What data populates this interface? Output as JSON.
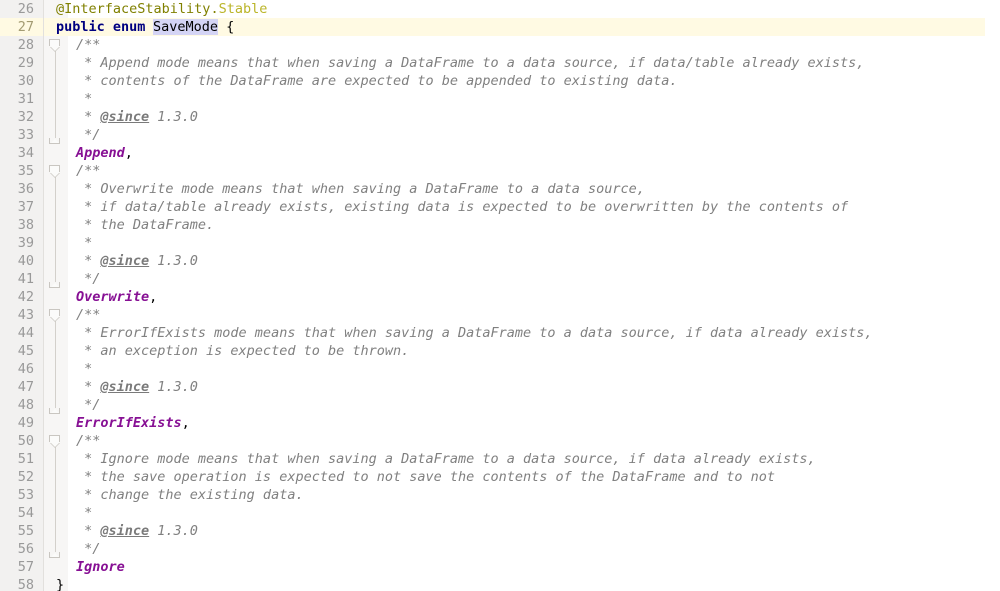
{
  "editor": {
    "language": "java",
    "theme": "light",
    "font_size_px": 13.5,
    "line_height_px": 18,
    "first_line_number": 26,
    "last_line_number": 58,
    "caret_line_number": 27,
    "caret_line_bg": "#fffae3",
    "selection_text": "SaveMode",
    "selection_bg": "#d4d4f5",
    "gutter_bg": "#f2f1f0",
    "fold_strip_bg": "#f7f6f5",
    "background": "#ffffff",
    "colors": {
      "line_number": "#999999",
      "keyword": "#000080",
      "annotation": "#808000",
      "annotation_type": "#bbb529",
      "comment": "#808080",
      "javadoc_tag": "#7a7a7a",
      "enum_constant": "#871094",
      "plain_text": "#000000"
    }
  },
  "lines": [
    {
      "num": "26",
      "indent": 0,
      "tokens": [
        {
          "t": "@InterfaceStability",
          "c": "anno"
        },
        {
          "t": ".",
          "c": "anno"
        },
        {
          "t": "Stable",
          "c": "anno-t"
        }
      ]
    },
    {
      "num": "27",
      "indent": 0,
      "tokens": [
        {
          "t": "public",
          "c": "kw"
        },
        {
          "t": " ",
          "c": "plain"
        },
        {
          "t": "enum",
          "c": "kw"
        },
        {
          "t": " ",
          "c": "plain"
        },
        {
          "t": "SaveMode",
          "c": "sel-caret"
        },
        {
          "t": " {",
          "c": "plain"
        }
      ]
    },
    {
      "num": "28",
      "indent": 1,
      "tokens": [
        {
          "t": "/**",
          "c": "cmt"
        }
      ]
    },
    {
      "num": "29",
      "indent": 1,
      "tokens": [
        {
          "t": " * Append mode means that when saving a DataFrame to a data source, if data/table already exists,",
          "c": "cmt"
        }
      ]
    },
    {
      "num": "30",
      "indent": 1,
      "tokens": [
        {
          "t": " * contents of the DataFrame are expected to be appended to existing data.",
          "c": "cmt"
        }
      ]
    },
    {
      "num": "31",
      "indent": 1,
      "tokens": [
        {
          "t": " *",
          "c": "cmt"
        }
      ]
    },
    {
      "num": "32",
      "indent": 1,
      "tokens": [
        {
          "t": " * ",
          "c": "cmt"
        },
        {
          "t": "@since",
          "c": "tag"
        },
        {
          "t": " 1.3.0",
          "c": "cmt"
        }
      ]
    },
    {
      "num": "33",
      "indent": 1,
      "tokens": [
        {
          "t": " */",
          "c": "cmt"
        }
      ]
    },
    {
      "num": "34",
      "indent": 1,
      "tokens": [
        {
          "t": "Append",
          "c": "enumc"
        },
        {
          "t": ",",
          "c": "plain"
        }
      ]
    },
    {
      "num": "35",
      "indent": 1,
      "tokens": [
        {
          "t": "/**",
          "c": "cmt"
        }
      ]
    },
    {
      "num": "36",
      "indent": 1,
      "tokens": [
        {
          "t": " * Overwrite mode means that when saving a DataFrame to a data source,",
          "c": "cmt"
        }
      ]
    },
    {
      "num": "37",
      "indent": 1,
      "tokens": [
        {
          "t": " * if data/table already exists, existing data is expected to be overwritten by the contents of",
          "c": "cmt"
        }
      ]
    },
    {
      "num": "38",
      "indent": 1,
      "tokens": [
        {
          "t": " * the DataFrame.",
          "c": "cmt"
        }
      ]
    },
    {
      "num": "39",
      "indent": 1,
      "tokens": [
        {
          "t": " *",
          "c": "cmt"
        }
      ]
    },
    {
      "num": "40",
      "indent": 1,
      "tokens": [
        {
          "t": " * ",
          "c": "cmt"
        },
        {
          "t": "@since",
          "c": "tag"
        },
        {
          "t": " 1.3.0",
          "c": "cmt"
        }
      ]
    },
    {
      "num": "41",
      "indent": 1,
      "tokens": [
        {
          "t": " */",
          "c": "cmt"
        }
      ]
    },
    {
      "num": "42",
      "indent": 1,
      "tokens": [
        {
          "t": "Overwrite",
          "c": "enumc"
        },
        {
          "t": ",",
          "c": "plain"
        }
      ]
    },
    {
      "num": "43",
      "indent": 1,
      "tokens": [
        {
          "t": "/**",
          "c": "cmt"
        }
      ]
    },
    {
      "num": "44",
      "indent": 1,
      "tokens": [
        {
          "t": " * ErrorIfExists mode means that when saving a DataFrame to a data source, if data already exists,",
          "c": "cmt"
        }
      ]
    },
    {
      "num": "45",
      "indent": 1,
      "tokens": [
        {
          "t": " * an exception is expected to be thrown.",
          "c": "cmt"
        }
      ]
    },
    {
      "num": "46",
      "indent": 1,
      "tokens": [
        {
          "t": " *",
          "c": "cmt"
        }
      ]
    },
    {
      "num": "47",
      "indent": 1,
      "tokens": [
        {
          "t": " * ",
          "c": "cmt"
        },
        {
          "t": "@since",
          "c": "tag"
        },
        {
          "t": " 1.3.0",
          "c": "cmt"
        }
      ]
    },
    {
      "num": "48",
      "indent": 1,
      "tokens": [
        {
          "t": " */",
          "c": "cmt"
        }
      ]
    },
    {
      "num": "49",
      "indent": 1,
      "tokens": [
        {
          "t": "ErrorIfExists",
          "c": "enumc"
        },
        {
          "t": ",",
          "c": "plain"
        }
      ]
    },
    {
      "num": "50",
      "indent": 1,
      "tokens": [
        {
          "t": "/**",
          "c": "cmt"
        }
      ]
    },
    {
      "num": "51",
      "indent": 1,
      "tokens": [
        {
          "t": " * Ignore mode means that when saving a DataFrame to a data source, if data already exists,",
          "c": "cmt"
        }
      ]
    },
    {
      "num": "52",
      "indent": 1,
      "tokens": [
        {
          "t": " * the save operation is expected to not save the contents of the DataFrame and to not",
          "c": "cmt"
        }
      ]
    },
    {
      "num": "53",
      "indent": 1,
      "tokens": [
        {
          "t": " * change the existing data.",
          "c": "cmt"
        }
      ]
    },
    {
      "num": "54",
      "indent": 1,
      "tokens": [
        {
          "t": " *",
          "c": "cmt"
        }
      ]
    },
    {
      "num": "55",
      "indent": 1,
      "tokens": [
        {
          "t": " * ",
          "c": "cmt"
        },
        {
          "t": "@since",
          "c": "tag"
        },
        {
          "t": " 1.3.0",
          "c": "cmt"
        }
      ]
    },
    {
      "num": "56",
      "indent": 1,
      "tokens": [
        {
          "t": " */",
          "c": "cmt"
        }
      ]
    },
    {
      "num": "57",
      "indent": 1,
      "tokens": [
        {
          "t": "Ignore",
          "c": "enumc"
        }
      ]
    },
    {
      "num": "58",
      "indent": 0,
      "tokens": [
        {
          "t": "}",
          "c": "plain"
        }
      ]
    }
  ],
  "fold_regions": [
    {
      "start_line": "28",
      "end_line": "33",
      "state": "expanded"
    },
    {
      "start_line": "35",
      "end_line": "41",
      "state": "expanded"
    },
    {
      "start_line": "43",
      "end_line": "48",
      "state": "expanded"
    },
    {
      "start_line": "50",
      "end_line": "56",
      "state": "expanded"
    }
  ]
}
